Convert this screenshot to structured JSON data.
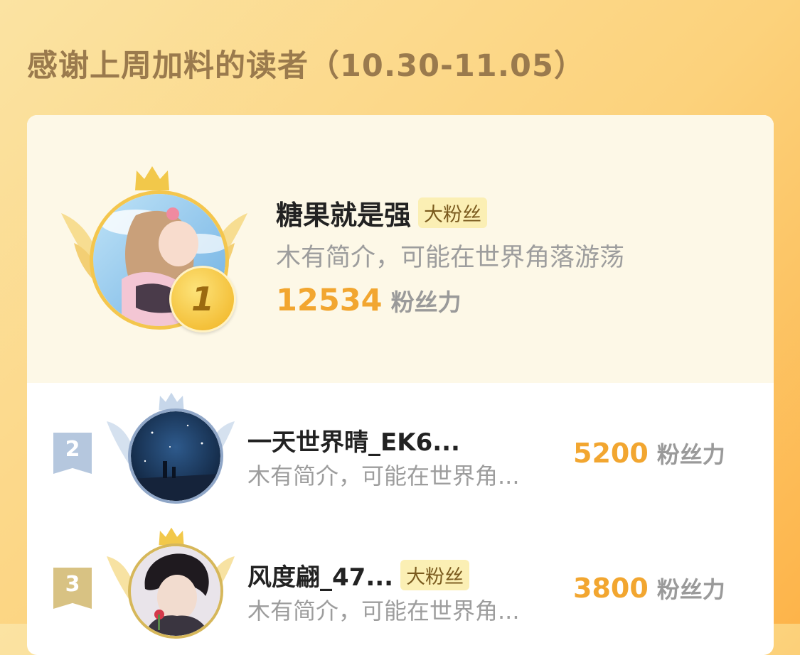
{
  "header": {
    "title": "感谢上周加料的读者（10.30-11.05）"
  },
  "colors": {
    "accent_score": "#f2a630",
    "gold_crown": "#f2c84a",
    "silver_crown": "#b9cde6",
    "badge_bg": "#fbefb4"
  },
  "ranking": [
    {
      "rank": "1",
      "name": "糖果就是强",
      "badge": "大粉丝",
      "description": "木有简介，可能在世界角落游荡",
      "score": "12534",
      "score_unit": "粉丝力",
      "crown": "gold-crown-icon"
    },
    {
      "rank": "2",
      "name": "一天世界晴_EK6...",
      "badge": "",
      "description": "木有简介，可能在世界角...",
      "score": "5200",
      "score_unit": "粉丝力",
      "crown": "silver-crown-icon"
    },
    {
      "rank": "3",
      "name": "风度翩_47...",
      "badge": "大粉丝",
      "description": "木有简介，可能在世界角...",
      "score": "3800",
      "score_unit": "粉丝力",
      "crown": "gold-crown-icon"
    }
  ]
}
